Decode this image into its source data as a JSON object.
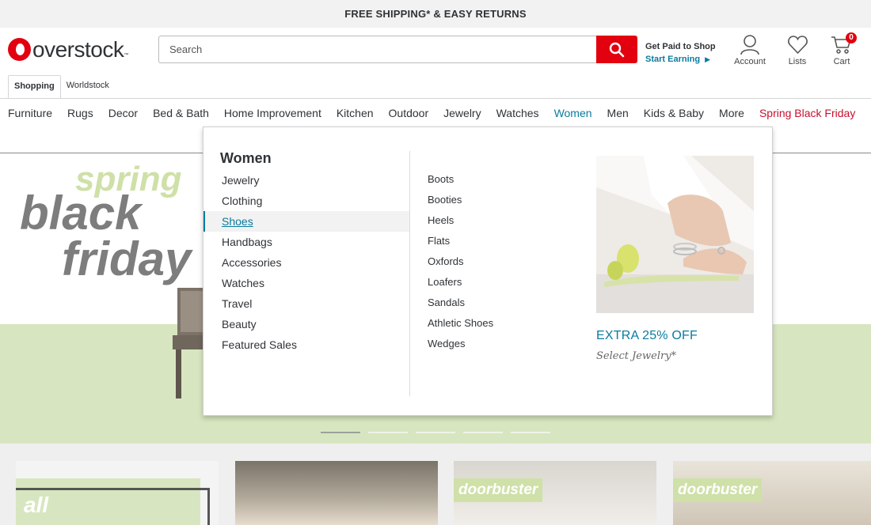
{
  "topbar": {
    "text": "FREE SHIPPING* & EASY RETURNS"
  },
  "header": {
    "logo_text": "overstock",
    "logo_tm": "™",
    "search": {
      "placeholder": "Search",
      "value": ""
    },
    "get_paid": {
      "title": "Get Paid to Shop",
      "link": "Start Earning"
    },
    "account_label": "Account",
    "lists_label": "Lists",
    "cart_label": "Cart",
    "cart_count": "0"
  },
  "subtabs": [
    {
      "label": "Shopping",
      "active": true
    },
    {
      "label": "Worldstock",
      "active": false
    }
  ],
  "nav": [
    {
      "label": "Furniture"
    },
    {
      "label": "Rugs"
    },
    {
      "label": "Decor"
    },
    {
      "label": "Bed & Bath"
    },
    {
      "label": "Home Improvement"
    },
    {
      "label": "Kitchen"
    },
    {
      "label": "Outdoor"
    },
    {
      "label": "Jewelry"
    },
    {
      "label": "Watches"
    },
    {
      "label": "Women",
      "active": true
    },
    {
      "label": "Men"
    },
    {
      "label": "Kids & Baby"
    },
    {
      "label": "More"
    },
    {
      "label": "Spring Black Friday",
      "highlight": true
    }
  ],
  "hero": {
    "spring": "spring",
    "black": "black",
    "friday": "friday"
  },
  "tiles": {
    "t1_text": "all",
    "t3_text": "doorbuster",
    "t4_text": "doorbuster"
  },
  "megamenu": {
    "title": "Women",
    "categories": [
      "Jewelry",
      "Clothing",
      "Shoes",
      "Handbags",
      "Accessories",
      "Watches",
      "Travel",
      "Beauty",
      "Featured Sales"
    ],
    "active_category": "Shoes",
    "subcategories": [
      "Boots",
      "Booties",
      "Heels",
      "Flats",
      "Oxfords",
      "Loafers",
      "Sandals",
      "Athletic Shoes",
      "Wedges"
    ],
    "promo": {
      "title": "EXTRA 25% OFF",
      "subtitle": "Select Jewelry*"
    }
  },
  "colors": {
    "brand_red": "#e3000f",
    "link_teal": "#0a7b9e",
    "sale_red": "#c8102e",
    "hero_green": "#d7e6c0"
  },
  "icons": [
    "search-icon",
    "account-icon",
    "heart-icon",
    "cart-icon",
    "chevron-right-icon"
  ]
}
